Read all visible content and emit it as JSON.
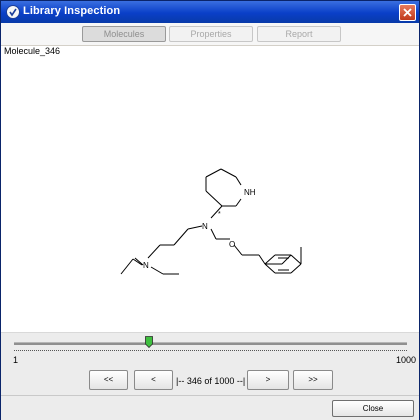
{
  "window": {
    "title": "Library Inspection"
  },
  "tabs": [
    {
      "label": "Molecules",
      "active": true
    },
    {
      "label": "Properties",
      "active": false
    },
    {
      "label": "Report",
      "active": false
    }
  ],
  "molecule": {
    "name": "Molecule_346",
    "atom_labels": {
      "nh": "NH",
      "stereo": "*",
      "n_center": "N",
      "n_left": "N",
      "o": "O"
    }
  },
  "slider": {
    "min_label": "1",
    "max_label": "1000",
    "value": 346,
    "min": 1,
    "max": 1000
  },
  "navigation": {
    "first_label": "<<",
    "prev_label": "<",
    "counter_text": "|-- 346 of 1000 --|",
    "next_label": ">",
    "last_label": ">>"
  },
  "footer": {
    "close_label": "Close"
  },
  "colors": {
    "titlebar": "#0a3fc8",
    "slider_thumb": "#3fbf3f"
  }
}
